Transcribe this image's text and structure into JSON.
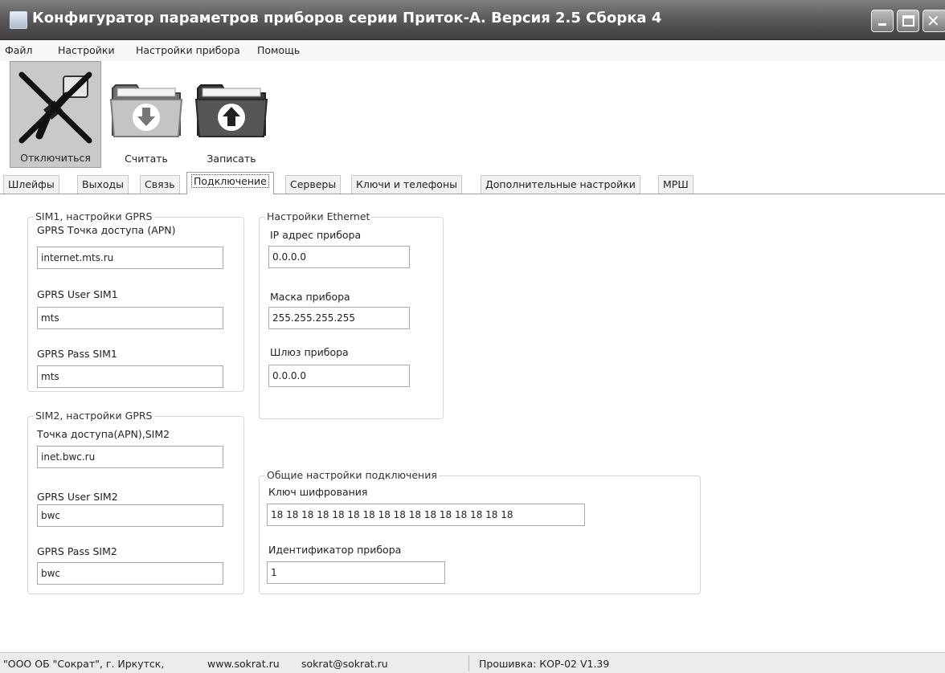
{
  "window": {
    "title": "Конфигуратор параметров приборов серии Приток-А. Версия 2.5 Сборка 4",
    "icon": "app-icon",
    "controls": [
      "minimize-icon",
      "maximize-icon",
      "close-icon"
    ],
    "close_glyph": "✕"
  },
  "menu": [
    "Файл",
    "Настройки",
    "Настройки прибора",
    "Помощь"
  ],
  "toolbar": {
    "disconnect_label": "Отключиться",
    "read_label": "Считать",
    "write_label": "Записать"
  },
  "tabs": [
    "Шлейфы",
    "Выходы",
    "Связь",
    "Подключение",
    "Серверы",
    "Ключи и телефоны",
    "Дополнительные настройки",
    "МРШ"
  ],
  "active_tab": "Подключение",
  "sim1": {
    "legend": "SIM1, настройки GPRS",
    "apn_label": "GPRS Точка доступа (APN)",
    "apn_value": "internet.mts.ru",
    "user_label": "GPRS User SIM1",
    "user_value": "mts",
    "pass_label": "GPRS Pass SIM1",
    "pass_value": "mts"
  },
  "sim2": {
    "legend": "SIM2, настройки GPRS",
    "apn_label": "Точка доступа(APN),SIM2",
    "apn_value": "inet.bwc.ru",
    "user_label": "GPRS User SIM2",
    "user_value": "bwc",
    "pass_label": "GPRS Pass SIM2",
    "pass_value": "bwc"
  },
  "ethernet": {
    "legend": "Настройки Ethernet",
    "ip_label": "IP адрес прибора",
    "ip_value": "0.0.0.0",
    "mask_label": "Маска прибора",
    "mask_value": "255.255.255.255",
    "gateway_label": "Шлюз прибора",
    "gateway_value": "0.0.0.0"
  },
  "general": {
    "legend": "Общие настройки подключения",
    "key_label": "Ключ шифрования",
    "key_value": "18 18 18 18 18 18 18 18 18 18 18 18 18 18 18 18",
    "id_label": "Идентификатор прибора",
    "id_value": "1"
  },
  "status": {
    "company": "\"ООО ОБ \"Сократ\", г. Иркутск,",
    "website": "www.sokrat.ru",
    "email": "sokrat@sokrat.ru",
    "firmware": "Прошивка: КОР-02 V1.39"
  },
  "colors": {
    "titlebar": "#5c5c5c",
    "folder_body": "#6f6f6f",
    "folder_light": "#c4c4c4",
    "active_tool_bg": "#c9c9c9"
  }
}
